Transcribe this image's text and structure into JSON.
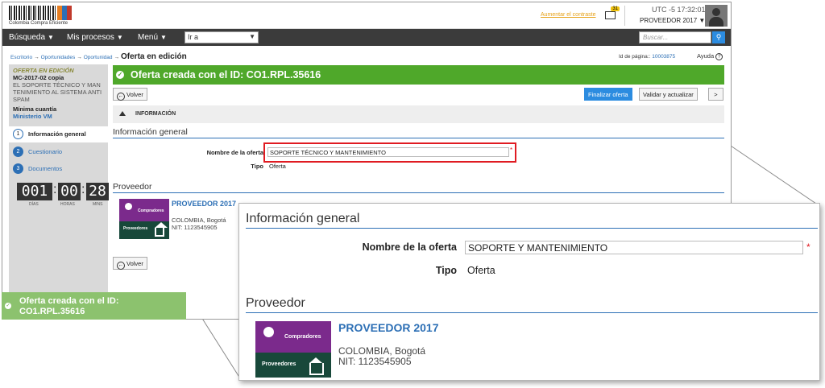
{
  "header": {
    "logo_text": "Colombia Compra Eficiente",
    "contrast_link": "Aumentar el contraste",
    "mail_count": "31",
    "utc_label": "UTC -5",
    "time": "17:32:01",
    "user": "PROVEEDOR 2017"
  },
  "nav": {
    "items": [
      "Búsqueda",
      "Mis procesos",
      "Menú"
    ],
    "goto_value": "Ir a",
    "search_placeholder": "Buscar..."
  },
  "breadcrumb": {
    "items": [
      "Escritorio",
      "Oportunidades",
      "Oportunidad"
    ],
    "current": "Oferta en edición",
    "page_id_label": "Id de página::",
    "page_id": "10003875",
    "help": "Ayuda"
  },
  "sidebar": {
    "status": "OFERTA EN EDICIÓN",
    "code": "MC-2017-02 copia",
    "description": "EL SOPORTE TÉCNICO Y MAN TENIMIENTO AL SISTEMA ANTI SPAM",
    "modality": "Mínima cuantía",
    "entity": "Ministerio VM",
    "steps": [
      {
        "num": "1",
        "label": "Información general"
      },
      {
        "num": "2",
        "label": "Cuestionario"
      },
      {
        "num": "3",
        "label": "Documentos"
      }
    ],
    "timer": {
      "days": "001",
      "hours": "00",
      "mins": "28",
      "days_label": "DÍAS",
      "hours_label": "HORAS",
      "mins_label": "MINS"
    }
  },
  "main": {
    "banner": "Oferta creada con el ID: CO1.RPL.35616",
    "back_label": "Volver",
    "finalize_label": "Finalizar oferta",
    "validate_label": "Validar y actualizar",
    "next_label": ">",
    "info_header": "INFORMACIÓN",
    "section_general": "Información general",
    "name_label": "Nombre de la oferta",
    "name_value": "SOPORTE TÉCNICO Y MANTENIMIENTO",
    "type_label": "Tipo",
    "type_value": "Oferta",
    "section_provider": "Proveedor",
    "provider_name": "PROVEEDOR 2017",
    "provider_location": "COLOMBIA, Bogotá",
    "provider_nit": "NIT: 1123545905",
    "logo_top": "Compradores",
    "logo_bottom": "Proveedores",
    "required_mark": "*"
  },
  "toast": {
    "line1": "Oferta creada con el ID:",
    "line2": "CO1.RPL.35616"
  },
  "zoom": {
    "section_general": "Información general",
    "name_label": "Nombre de la oferta",
    "name_value": "SOPORTE Y MANTENIMIENTO",
    "type_label": "Tipo",
    "type_value": "Oferta",
    "section_provider": "Proveedor",
    "provider_name": "PROVEEDOR 2017",
    "provider_location": "COLOMBIA, Bogotá",
    "provider_nit": "NIT: 1123545905",
    "logo_top": "Compradores",
    "logo_bottom": "Proveedores"
  },
  "colors": {
    "banner_green": "#4fa82a",
    "link_blue": "#2c6fb5",
    "highlight_red": "#e01b22",
    "primary_button": "#2c8ce0"
  }
}
